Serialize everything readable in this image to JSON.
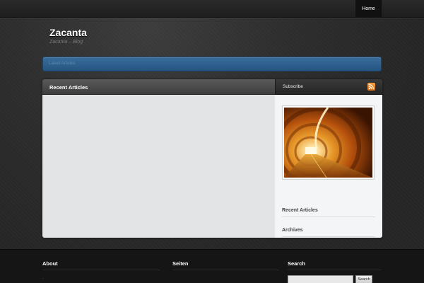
{
  "nav": {
    "home_label": "Home"
  },
  "site": {
    "title": "Zacanta",
    "tagline": "Zacanta – Blog"
  },
  "breadcrumb": {
    "text": "Latest Articles"
  },
  "content": {
    "header_title": "Recent Articles"
  },
  "sidebar": {
    "subscribe_label": "Subscribe",
    "rss_icon": "rss-feed-icon",
    "widgets": [
      {
        "title": "Recent Articles"
      },
      {
        "title": "Archives"
      }
    ]
  },
  "footer": {
    "columns": [
      {
        "title": "About",
        "text": "."
      },
      {
        "title": "Seiten"
      },
      {
        "title": "Search"
      }
    ],
    "search": {
      "placeholder": "",
      "button_label": "Search"
    }
  },
  "colors": {
    "accent_blue": "#2f6496",
    "rss_orange": "#ef8a2a",
    "background": "#2b2b2b",
    "footer": "#151515"
  }
}
